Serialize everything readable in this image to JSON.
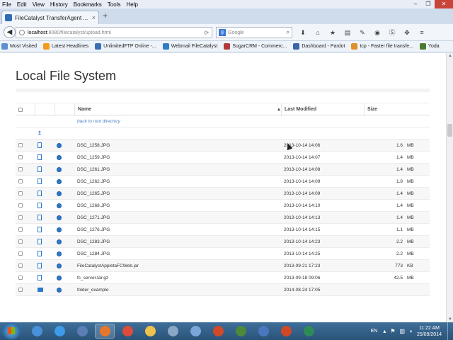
{
  "menu": [
    {
      "label": "File",
      "key": "F"
    },
    {
      "label": "Edit",
      "key": "E"
    },
    {
      "label": "View",
      "key": "V"
    },
    {
      "label": "History",
      "key": "s"
    },
    {
      "label": "Bookmarks",
      "key": "B"
    },
    {
      "label": "Tools",
      "key": "T"
    },
    {
      "label": "Help",
      "key": "H"
    }
  ],
  "window_controls": {
    "minimize": "–",
    "maximize": "❐",
    "close": "✕"
  },
  "tab": {
    "title": "FileCatalyst TransferAgent ...",
    "close": "×",
    "new": "+"
  },
  "nav": {
    "url_host": "localhost",
    "url_path": ":8080/filecatalyst/upload.html",
    "search_placeholder": "Google",
    "search_engine": "g"
  },
  "bookmarks": [
    {
      "label": "Most Visited",
      "color": "#5b8fd0"
    },
    {
      "label": "Latest Headlines",
      "color": "#f29b1d"
    },
    {
      "label": "UnlimitedFTP Online -...",
      "color": "#3b6fb5"
    },
    {
      "label": "Webmail FileCatalyst",
      "color": "#2f7ac7"
    },
    {
      "label": "SugarCRM - Commerc...",
      "color": "#b33a3a"
    },
    {
      "label": "Dashboard - Pardot",
      "color": "#3a63a8"
    },
    {
      "label": "tcp - Faster file transfe...",
      "color": "#e0902a"
    },
    {
      "label": "Yoda",
      "color": "#4a7a2e"
    }
  ],
  "page": {
    "title": "Local File System",
    "columns": {
      "name": "Name",
      "modified": "Last Modified",
      "size": "Size"
    },
    "sort_arrow": "▲",
    "back_link": "back to root directory",
    "up_arrow": "↥"
  },
  "files": [
    {
      "name": "DSC_1258.JPG",
      "modified": "2013-10-14 14:06",
      "size": "1.6",
      "unit": "MB",
      "type": "file"
    },
    {
      "name": "DSC_1259.JPG",
      "modified": "2013-10-14 14:07",
      "size": "1.4",
      "unit": "MB",
      "type": "file"
    },
    {
      "name": "DSC_1261.JPG",
      "modified": "2013-10-14 14:08",
      "size": "1.4",
      "unit": "MB",
      "type": "file"
    },
    {
      "name": "DSC_1262.JPG",
      "modified": "2013-10-14 14:09",
      "size": "1.8",
      "unit": "MB",
      "type": "file"
    },
    {
      "name": "DSC_1265.JPG",
      "modified": "2013-10-14 14:09",
      "size": "1.4",
      "unit": "MB",
      "type": "file"
    },
    {
      "name": "DSC_1268.JPG",
      "modified": "2013-10-14 14:10",
      "size": "1.4",
      "unit": "MB",
      "type": "file"
    },
    {
      "name": "DSC_1271.JPG",
      "modified": "2013-10-14 14:13",
      "size": "1.4",
      "unit": "MB",
      "type": "file"
    },
    {
      "name": "DSC_1276.JPG",
      "modified": "2013-10-14 14:15",
      "size": "1.1",
      "unit": "MB",
      "type": "file"
    },
    {
      "name": "DSC_1283.JPG",
      "modified": "2013-10-14 14:23",
      "size": "2.2",
      "unit": "MB",
      "type": "file"
    },
    {
      "name": "DSC_1284.JPG",
      "modified": "2013-10-14 14:25",
      "size": "2.2",
      "unit": "MB",
      "type": "file"
    },
    {
      "name": "FileCatalystAppletaFCWeb.jar",
      "modified": "2013-09-21 17:23",
      "size": "773",
      "unit": "KB",
      "type": "file"
    },
    {
      "name": "fc_server.tar.gz",
      "modified": "2013-09-18 09:06",
      "size": "42.5",
      "unit": "MB",
      "type": "file"
    },
    {
      "name": "folder_example",
      "modified": "2014-08-24 17:05",
      "size": "",
      "unit": "",
      "type": "folder"
    }
  ],
  "taskbar": {
    "icons": [
      {
        "name": "network-app-icon",
        "color": "#4a90d9"
      },
      {
        "name": "internet-explorer-icon",
        "color": "#3d9be9"
      },
      {
        "name": "thunderbird-icon",
        "color": "#5b7fb5"
      },
      {
        "name": "firefox-icon",
        "color": "#e8772e",
        "active": true
      },
      {
        "name": "chrome-icon",
        "color": "#dd4b39"
      },
      {
        "name": "file-explorer-icon",
        "color": "#f0c24b"
      },
      {
        "name": "tools-icon",
        "color": "#8aa7c4"
      },
      {
        "name": "virtualbox-icon",
        "color": "#7aa6d8"
      },
      {
        "name": "java-icon",
        "color": "#d04a2a"
      },
      {
        "name": "terminal-icon",
        "color": "#4c8a3a"
      },
      {
        "name": "settings-gear-icon",
        "color": "#4a78c0"
      },
      {
        "name": "powerpoint-icon",
        "color": "#d24726"
      },
      {
        "name": "spreadsheet-icon",
        "color": "#2e8b57"
      }
    ],
    "language": "EN",
    "time": "11:22 AM",
    "date": "25/09/2014"
  }
}
